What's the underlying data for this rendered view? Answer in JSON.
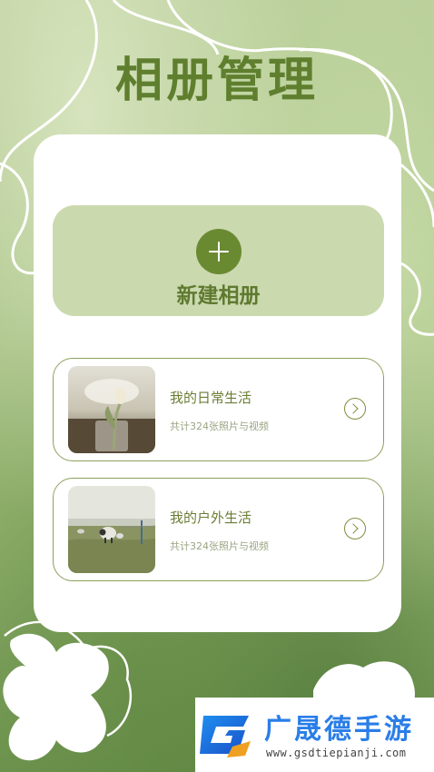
{
  "header": {
    "title": "相册管理"
  },
  "new_album": {
    "label": "新建相册",
    "icon": "plus-icon"
  },
  "albums": [
    {
      "name": "我的日常生活",
      "count_text": "共计324张照片与视频",
      "arrow_icon": "chevron-right-circle-icon"
    },
    {
      "name": "我的户外生活",
      "count_text": "共计324张照片与视频",
      "arrow_icon": "chevron-right-circle-icon"
    }
  ],
  "watermark": {
    "title": "广晟德手游",
    "url": "www.gsdtiepianji.com"
  },
  "colors": {
    "accent": "#6a8a32",
    "title": "#5f7f2f",
    "new_album_bg": "#cbd9af",
    "card_bg": "#ffffff",
    "item_border": "#8ea05e",
    "watermark_blue": "#2a7ee8"
  }
}
